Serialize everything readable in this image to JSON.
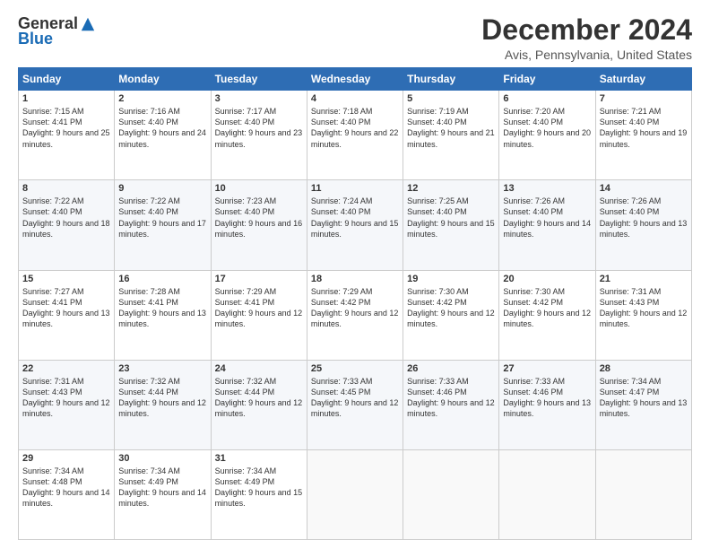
{
  "logo": {
    "general": "General",
    "blue": "Blue"
  },
  "title": "December 2024",
  "subtitle": "Avis, Pennsylvania, United States",
  "days": [
    "Sunday",
    "Monday",
    "Tuesday",
    "Wednesday",
    "Thursday",
    "Friday",
    "Saturday"
  ],
  "weeks": [
    [
      {
        "day": "1",
        "sunrise": "7:15 AM",
        "sunset": "4:41 PM",
        "daylight": "9 hours and 25 minutes."
      },
      {
        "day": "2",
        "sunrise": "7:16 AM",
        "sunset": "4:40 PM",
        "daylight": "9 hours and 24 minutes."
      },
      {
        "day": "3",
        "sunrise": "7:17 AM",
        "sunset": "4:40 PM",
        "daylight": "9 hours and 23 minutes."
      },
      {
        "day": "4",
        "sunrise": "7:18 AM",
        "sunset": "4:40 PM",
        "daylight": "9 hours and 22 minutes."
      },
      {
        "day": "5",
        "sunrise": "7:19 AM",
        "sunset": "4:40 PM",
        "daylight": "9 hours and 21 minutes."
      },
      {
        "day": "6",
        "sunrise": "7:20 AM",
        "sunset": "4:40 PM",
        "daylight": "9 hours and 20 minutes."
      },
      {
        "day": "7",
        "sunrise": "7:21 AM",
        "sunset": "4:40 PM",
        "daylight": "9 hours and 19 minutes."
      }
    ],
    [
      {
        "day": "8",
        "sunrise": "7:22 AM",
        "sunset": "4:40 PM",
        "daylight": "9 hours and 18 minutes."
      },
      {
        "day": "9",
        "sunrise": "7:22 AM",
        "sunset": "4:40 PM",
        "daylight": "9 hours and 17 minutes."
      },
      {
        "day": "10",
        "sunrise": "7:23 AM",
        "sunset": "4:40 PM",
        "daylight": "9 hours and 16 minutes."
      },
      {
        "day": "11",
        "sunrise": "7:24 AM",
        "sunset": "4:40 PM",
        "daylight": "9 hours and 15 minutes."
      },
      {
        "day": "12",
        "sunrise": "7:25 AM",
        "sunset": "4:40 PM",
        "daylight": "9 hours and 15 minutes."
      },
      {
        "day": "13",
        "sunrise": "7:26 AM",
        "sunset": "4:40 PM",
        "daylight": "9 hours and 14 minutes."
      },
      {
        "day": "14",
        "sunrise": "7:26 AM",
        "sunset": "4:40 PM",
        "daylight": "9 hours and 13 minutes."
      }
    ],
    [
      {
        "day": "15",
        "sunrise": "7:27 AM",
        "sunset": "4:41 PM",
        "daylight": "9 hours and 13 minutes."
      },
      {
        "day": "16",
        "sunrise": "7:28 AM",
        "sunset": "4:41 PM",
        "daylight": "9 hours and 13 minutes."
      },
      {
        "day": "17",
        "sunrise": "7:29 AM",
        "sunset": "4:41 PM",
        "daylight": "9 hours and 12 minutes."
      },
      {
        "day": "18",
        "sunrise": "7:29 AM",
        "sunset": "4:42 PM",
        "daylight": "9 hours and 12 minutes."
      },
      {
        "day": "19",
        "sunrise": "7:30 AM",
        "sunset": "4:42 PM",
        "daylight": "9 hours and 12 minutes."
      },
      {
        "day": "20",
        "sunrise": "7:30 AM",
        "sunset": "4:42 PM",
        "daylight": "9 hours and 12 minutes."
      },
      {
        "day": "21",
        "sunrise": "7:31 AM",
        "sunset": "4:43 PM",
        "daylight": "9 hours and 12 minutes."
      }
    ],
    [
      {
        "day": "22",
        "sunrise": "7:31 AM",
        "sunset": "4:43 PM",
        "daylight": "9 hours and 12 minutes."
      },
      {
        "day": "23",
        "sunrise": "7:32 AM",
        "sunset": "4:44 PM",
        "daylight": "9 hours and 12 minutes."
      },
      {
        "day": "24",
        "sunrise": "7:32 AM",
        "sunset": "4:44 PM",
        "daylight": "9 hours and 12 minutes."
      },
      {
        "day": "25",
        "sunrise": "7:33 AM",
        "sunset": "4:45 PM",
        "daylight": "9 hours and 12 minutes."
      },
      {
        "day": "26",
        "sunrise": "7:33 AM",
        "sunset": "4:46 PM",
        "daylight": "9 hours and 12 minutes."
      },
      {
        "day": "27",
        "sunrise": "7:33 AM",
        "sunset": "4:46 PM",
        "daylight": "9 hours and 13 minutes."
      },
      {
        "day": "28",
        "sunrise": "7:34 AM",
        "sunset": "4:47 PM",
        "daylight": "9 hours and 13 minutes."
      }
    ],
    [
      {
        "day": "29",
        "sunrise": "7:34 AM",
        "sunset": "4:48 PM",
        "daylight": "9 hours and 14 minutes."
      },
      {
        "day": "30",
        "sunrise": "7:34 AM",
        "sunset": "4:49 PM",
        "daylight": "9 hours and 14 minutes."
      },
      {
        "day": "31",
        "sunrise": "7:34 AM",
        "sunset": "4:49 PM",
        "daylight": "9 hours and 15 minutes."
      },
      null,
      null,
      null,
      null
    ]
  ]
}
